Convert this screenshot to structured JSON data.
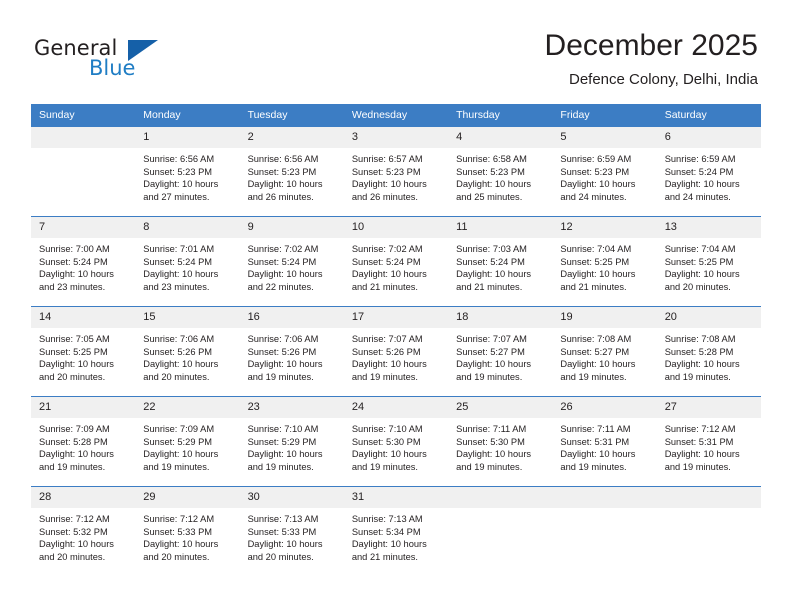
{
  "logo": {
    "word_top": "General",
    "word_bottom": "Blue",
    "triangle_color": "#1560a8",
    "blue_color": "#1f7dc4"
  },
  "header": {
    "title": "December 2025",
    "subtitle": "Defence Colony, Delhi, India"
  },
  "theme": {
    "header_blue": "#3c7dc4",
    "daynum_band": "#f0f0f0",
    "text": "#231f20"
  },
  "calendar": {
    "weekday_headers": [
      "Sunday",
      "Monday",
      "Tuesday",
      "Wednesday",
      "Thursday",
      "Friday",
      "Saturday"
    ],
    "weeks": [
      [
        {
          "day": "",
          "sunrise": "",
          "sunset": "",
          "daylight_line1": "",
          "daylight_line2": ""
        },
        {
          "day": "1",
          "sunrise": "Sunrise: 6:56 AM",
          "sunset": "Sunset: 5:23 PM",
          "daylight_line1": "Daylight: 10 hours",
          "daylight_line2": "and 27 minutes."
        },
        {
          "day": "2",
          "sunrise": "Sunrise: 6:56 AM",
          "sunset": "Sunset: 5:23 PM",
          "daylight_line1": "Daylight: 10 hours",
          "daylight_line2": "and 26 minutes."
        },
        {
          "day": "3",
          "sunrise": "Sunrise: 6:57 AM",
          "sunset": "Sunset: 5:23 PM",
          "daylight_line1": "Daylight: 10 hours",
          "daylight_line2": "and 26 minutes."
        },
        {
          "day": "4",
          "sunrise": "Sunrise: 6:58 AM",
          "sunset": "Sunset: 5:23 PM",
          "daylight_line1": "Daylight: 10 hours",
          "daylight_line2": "and 25 minutes."
        },
        {
          "day": "5",
          "sunrise": "Sunrise: 6:59 AM",
          "sunset": "Sunset: 5:23 PM",
          "daylight_line1": "Daylight: 10 hours",
          "daylight_line2": "and 24 minutes."
        },
        {
          "day": "6",
          "sunrise": "Sunrise: 6:59 AM",
          "sunset": "Sunset: 5:24 PM",
          "daylight_line1": "Daylight: 10 hours",
          "daylight_line2": "and 24 minutes."
        }
      ],
      [
        {
          "day": "7",
          "sunrise": "Sunrise: 7:00 AM",
          "sunset": "Sunset: 5:24 PM",
          "daylight_line1": "Daylight: 10 hours",
          "daylight_line2": "and 23 minutes."
        },
        {
          "day": "8",
          "sunrise": "Sunrise: 7:01 AM",
          "sunset": "Sunset: 5:24 PM",
          "daylight_line1": "Daylight: 10 hours",
          "daylight_line2": "and 23 minutes."
        },
        {
          "day": "9",
          "sunrise": "Sunrise: 7:02 AM",
          "sunset": "Sunset: 5:24 PM",
          "daylight_line1": "Daylight: 10 hours",
          "daylight_line2": "and 22 minutes."
        },
        {
          "day": "10",
          "sunrise": "Sunrise: 7:02 AM",
          "sunset": "Sunset: 5:24 PM",
          "daylight_line1": "Daylight: 10 hours",
          "daylight_line2": "and 21 minutes."
        },
        {
          "day": "11",
          "sunrise": "Sunrise: 7:03 AM",
          "sunset": "Sunset: 5:24 PM",
          "daylight_line1": "Daylight: 10 hours",
          "daylight_line2": "and 21 minutes."
        },
        {
          "day": "12",
          "sunrise": "Sunrise: 7:04 AM",
          "sunset": "Sunset: 5:25 PM",
          "daylight_line1": "Daylight: 10 hours",
          "daylight_line2": "and 21 minutes."
        },
        {
          "day": "13",
          "sunrise": "Sunrise: 7:04 AM",
          "sunset": "Sunset: 5:25 PM",
          "daylight_line1": "Daylight: 10 hours",
          "daylight_line2": "and 20 minutes."
        }
      ],
      [
        {
          "day": "14",
          "sunrise": "Sunrise: 7:05 AM",
          "sunset": "Sunset: 5:25 PM",
          "daylight_line1": "Daylight: 10 hours",
          "daylight_line2": "and 20 minutes."
        },
        {
          "day": "15",
          "sunrise": "Sunrise: 7:06 AM",
          "sunset": "Sunset: 5:26 PM",
          "daylight_line1": "Daylight: 10 hours",
          "daylight_line2": "and 20 minutes."
        },
        {
          "day": "16",
          "sunrise": "Sunrise: 7:06 AM",
          "sunset": "Sunset: 5:26 PM",
          "daylight_line1": "Daylight: 10 hours",
          "daylight_line2": "and 19 minutes."
        },
        {
          "day": "17",
          "sunrise": "Sunrise: 7:07 AM",
          "sunset": "Sunset: 5:26 PM",
          "daylight_line1": "Daylight: 10 hours",
          "daylight_line2": "and 19 minutes."
        },
        {
          "day": "18",
          "sunrise": "Sunrise: 7:07 AM",
          "sunset": "Sunset: 5:27 PM",
          "daylight_line1": "Daylight: 10 hours",
          "daylight_line2": "and 19 minutes."
        },
        {
          "day": "19",
          "sunrise": "Sunrise: 7:08 AM",
          "sunset": "Sunset: 5:27 PM",
          "daylight_line1": "Daylight: 10 hours",
          "daylight_line2": "and 19 minutes."
        },
        {
          "day": "20",
          "sunrise": "Sunrise: 7:08 AM",
          "sunset": "Sunset: 5:28 PM",
          "daylight_line1": "Daylight: 10 hours",
          "daylight_line2": "and 19 minutes."
        }
      ],
      [
        {
          "day": "21",
          "sunrise": "Sunrise: 7:09 AM",
          "sunset": "Sunset: 5:28 PM",
          "daylight_line1": "Daylight: 10 hours",
          "daylight_line2": "and 19 minutes."
        },
        {
          "day": "22",
          "sunrise": "Sunrise: 7:09 AM",
          "sunset": "Sunset: 5:29 PM",
          "daylight_line1": "Daylight: 10 hours",
          "daylight_line2": "and 19 minutes."
        },
        {
          "day": "23",
          "sunrise": "Sunrise: 7:10 AM",
          "sunset": "Sunset: 5:29 PM",
          "daylight_line1": "Daylight: 10 hours",
          "daylight_line2": "and 19 minutes."
        },
        {
          "day": "24",
          "sunrise": "Sunrise: 7:10 AM",
          "sunset": "Sunset: 5:30 PM",
          "daylight_line1": "Daylight: 10 hours",
          "daylight_line2": "and 19 minutes."
        },
        {
          "day": "25",
          "sunrise": "Sunrise: 7:11 AM",
          "sunset": "Sunset: 5:30 PM",
          "daylight_line1": "Daylight: 10 hours",
          "daylight_line2": "and 19 minutes."
        },
        {
          "day": "26",
          "sunrise": "Sunrise: 7:11 AM",
          "sunset": "Sunset: 5:31 PM",
          "daylight_line1": "Daylight: 10 hours",
          "daylight_line2": "and 19 minutes."
        },
        {
          "day": "27",
          "sunrise": "Sunrise: 7:12 AM",
          "sunset": "Sunset: 5:31 PM",
          "daylight_line1": "Daylight: 10 hours",
          "daylight_line2": "and 19 minutes."
        }
      ],
      [
        {
          "day": "28",
          "sunrise": "Sunrise: 7:12 AM",
          "sunset": "Sunset: 5:32 PM",
          "daylight_line1": "Daylight: 10 hours",
          "daylight_line2": "and 20 minutes."
        },
        {
          "day": "29",
          "sunrise": "Sunrise: 7:12 AM",
          "sunset": "Sunset: 5:33 PM",
          "daylight_line1": "Daylight: 10 hours",
          "daylight_line2": "and 20 minutes."
        },
        {
          "day": "30",
          "sunrise": "Sunrise: 7:13 AM",
          "sunset": "Sunset: 5:33 PM",
          "daylight_line1": "Daylight: 10 hours",
          "daylight_line2": "and 20 minutes."
        },
        {
          "day": "31",
          "sunrise": "Sunrise: 7:13 AM",
          "sunset": "Sunset: 5:34 PM",
          "daylight_line1": "Daylight: 10 hours",
          "daylight_line2": "and 21 minutes."
        },
        {
          "day": "",
          "sunrise": "",
          "sunset": "",
          "daylight_line1": "",
          "daylight_line2": ""
        },
        {
          "day": "",
          "sunrise": "",
          "sunset": "",
          "daylight_line1": "",
          "daylight_line2": ""
        },
        {
          "day": "",
          "sunrise": "",
          "sunset": "",
          "daylight_line1": "",
          "daylight_line2": ""
        }
      ]
    ]
  }
}
